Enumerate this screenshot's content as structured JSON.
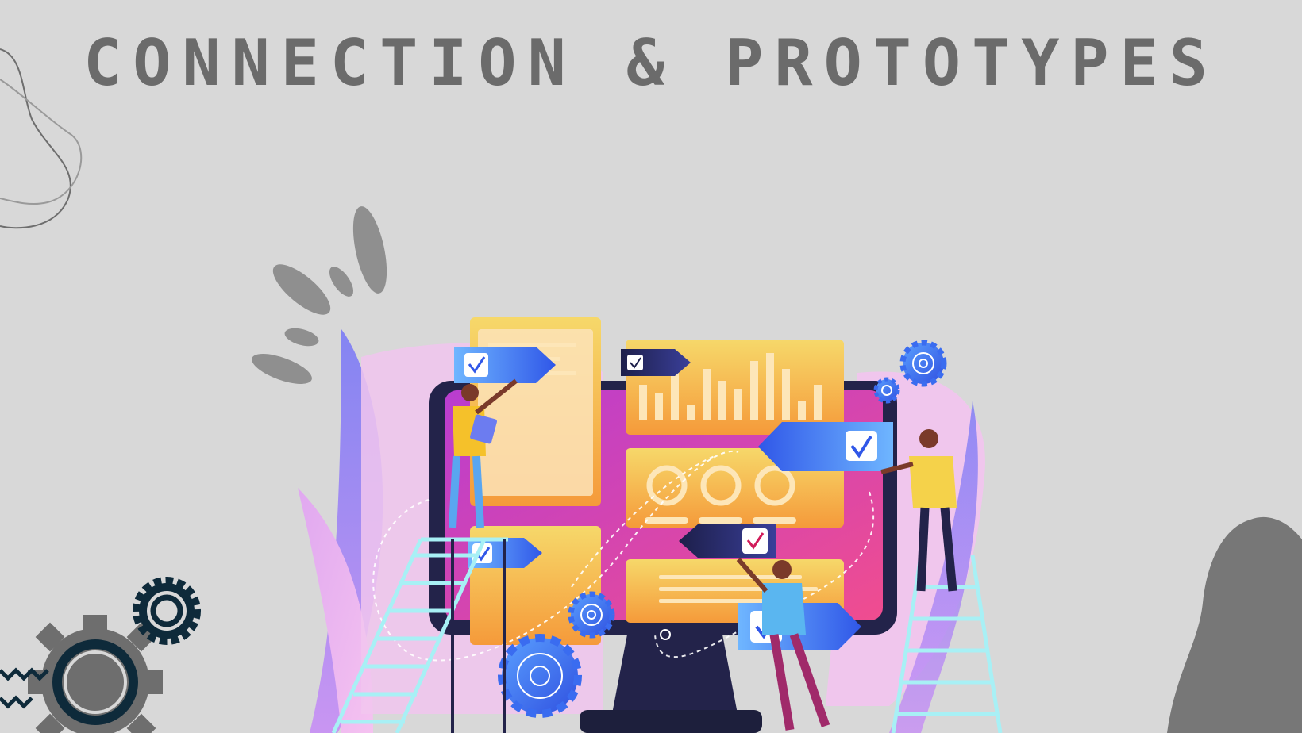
{
  "slide": {
    "title": "CONNECTION & PROTOTYPES"
  },
  "colors": {
    "background": "#d8d8d8",
    "title": "#6b6b6b",
    "dark_gray_shape": "#777777",
    "gear_gray": "#6e6e6e",
    "gear_navy": "#0e2a3a",
    "monitor_frame": "#23234a",
    "screen_pink": "#d63fb0",
    "panel_orange": "#f5b24c",
    "panel_yellow": "#f6d35a",
    "tag_blue": "#3d78f0",
    "tag_navy": "#1d1f4a",
    "ladder": "#a8f0f5"
  },
  "illustration": {
    "subject": "team building website prototype on monitor",
    "icons": [
      "checkmark-icon",
      "gear-icon",
      "bar-chart-icon",
      "donut-chart-icon"
    ]
  }
}
